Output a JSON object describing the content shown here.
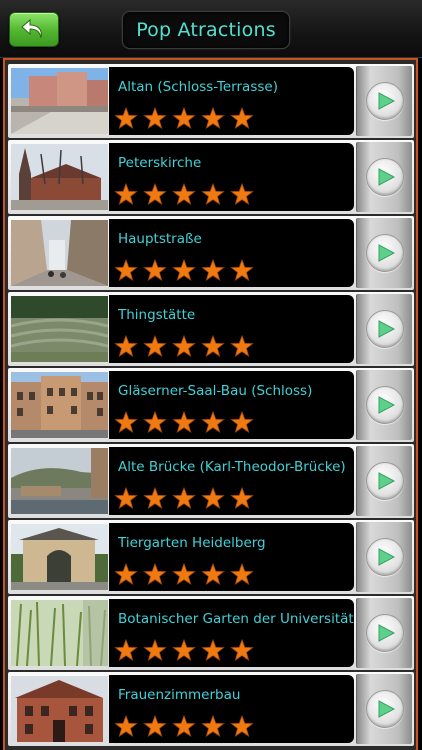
{
  "header": {
    "title": "Pop Atractions",
    "back_icon": "back-arrow-icon"
  },
  "colors": {
    "accent_frame": "#c8531e",
    "title_text": "#53e0d0",
    "item_text": "#3fd2d8",
    "star": "#f07a12",
    "back_button": "#52b52f",
    "go_arrow": "#5cd18a"
  },
  "items": [
    {
      "name": "Altan (Schloss-Terrasse)",
      "rating": 5,
      "thumb": "castle-terrace-photo"
    },
    {
      "name": "Peterskirche",
      "rating": 5,
      "thumb": "church-photo"
    },
    {
      "name": "Hauptstraße",
      "rating": 5,
      "thumb": "street-photo"
    },
    {
      "name": "Thingstätte",
      "rating": 5,
      "thumb": "amphitheater-photo"
    },
    {
      "name": "Gläserner-Saal-Bau (Schloss)",
      "rating": 5,
      "thumb": "castle-building-photo"
    },
    {
      "name": "Alte Brücke (Karl-Theodor-Brücke)",
      "rating": 5,
      "thumb": "old-bridge-photo"
    },
    {
      "name": "Tiergarten Heidelberg",
      "rating": 5,
      "thumb": "zoo-gate-photo"
    },
    {
      "name": "Botanischer Garten der Universität H...",
      "rating": 5,
      "thumb": "botanical-garden-photo"
    },
    {
      "name": "Frauenzimmerbau",
      "rating": 5,
      "thumb": "red-building-photo"
    }
  ]
}
